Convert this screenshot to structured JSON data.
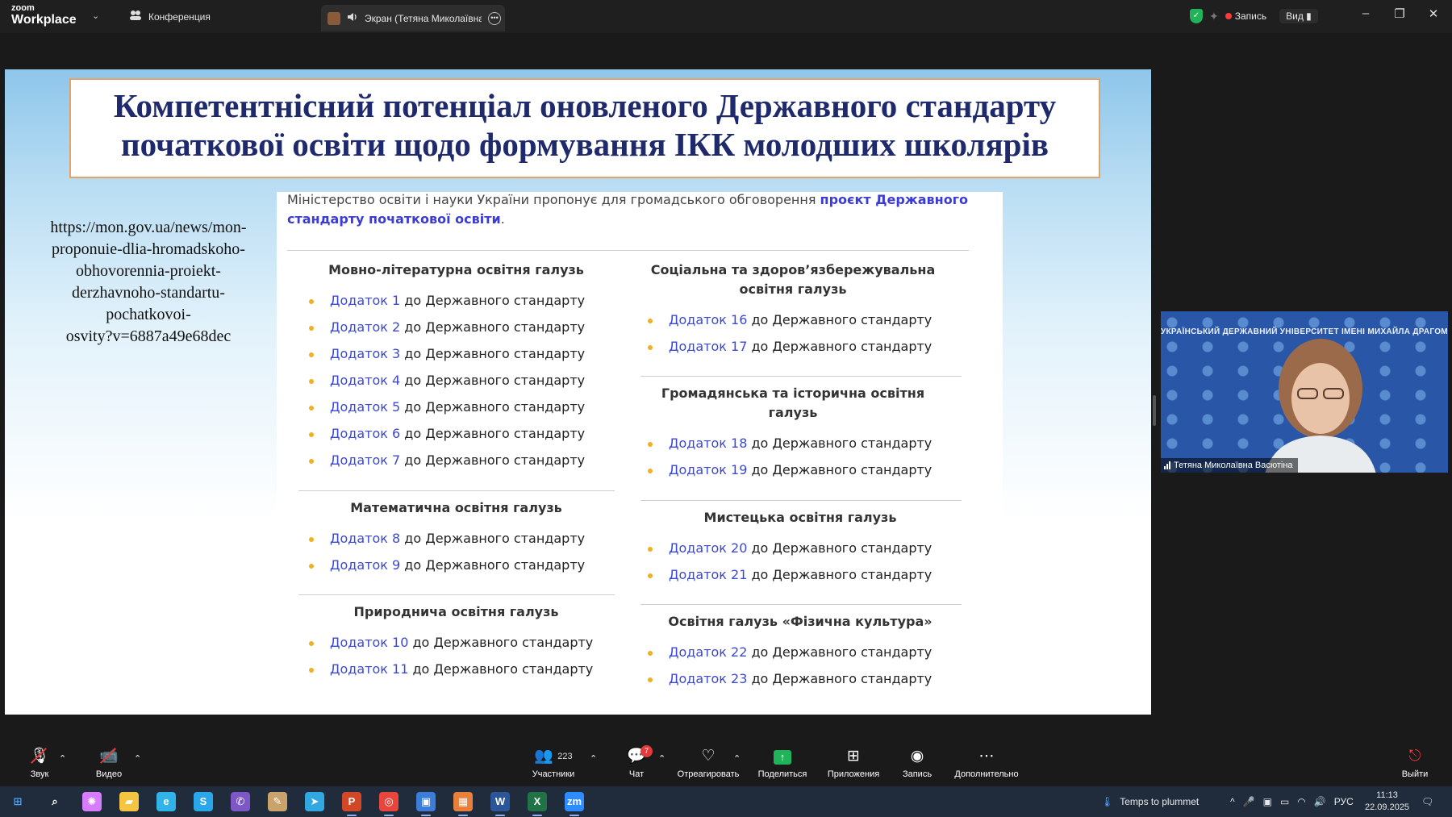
{
  "titlebar": {
    "logo_small": "zoom",
    "logo_big": "Workplace",
    "conference_label": "Конференция",
    "screen_tab_label": "Экран (Тетяна Миколаївна В",
    "record_label": "Запись",
    "view_label": "Вид",
    "colors": {
      "shield": "#1fb35a",
      "record_dot": "#ff3b3b"
    }
  },
  "slide": {
    "title_line1": "Компетентнісний потенціал оновленого Державного стандарту",
    "title_line2": "початкової освіти щодо формування ІКК молодших школярів",
    "url_lines": [
      "https://mon.gov.ua/news/mon-",
      "proponuie-dlia-hromadskoho-",
      "obhovorennia-proiekt-",
      "derzhavnoho-standartu-",
      "pochatkovoi-",
      "osvity?v=6887a49e68dec"
    ],
    "intro_text": "Міністерство освіти і науки України пропонує для громадського обговорення ",
    "intro_link": "проєкт Державного стандарту початкової освіти",
    "intro_end": ".",
    "suffix": " до Державного стандарту",
    "left_column": [
      {
        "heading": "Мовно-літературна освітня галузь",
        "items": [
          "Додаток 1",
          "Додаток 2",
          "Додаток 3",
          "Додаток 4",
          "Додаток 5",
          "Додаток 6",
          "Додаток 7"
        ]
      },
      {
        "heading": "Математична освітня галузь",
        "items": [
          "Додаток 8",
          "Додаток 9"
        ]
      },
      {
        "heading": "Природнича освітня галузь",
        "items": [
          "Додаток 10",
          "Додаток 11"
        ]
      }
    ],
    "right_column": [
      {
        "heading": "Соціальна та здоров’язбережувальна освітня галузь",
        "items": [
          "Додаток 16",
          "Додаток 17"
        ]
      },
      {
        "heading": "Громадянська та історична освітня галузь",
        "items": [
          "Додаток 18",
          "Додаток 19"
        ]
      },
      {
        "heading": "Мистецька освітня галузь",
        "items": [
          "Додаток 20",
          "Додаток 21"
        ]
      },
      {
        "heading": "Освітня галузь «Фізична культура»",
        "items": [
          "Додаток 22",
          "Додаток 23"
        ]
      }
    ],
    "colors": {
      "title": "#1e2a6c",
      "link": "#3b48d0",
      "bullet": "#f0b020",
      "title_border": "#e2a26a"
    }
  },
  "video": {
    "banner_text": "УКРАЇНСЬКИЙ ДЕРЖАВНИЙ УНІВЕРСИТЕТ ІМЕНІ МИХАЙЛА ДРАГОМАНОВА",
    "name": "Тетяна Миколаївна Васютіна"
  },
  "toolbar": {
    "audio": "Звук",
    "video": "Видео",
    "participants": "Участники",
    "participants_count": "223",
    "chat": "Чат",
    "chat_badge": "7",
    "react": "Отреагировать",
    "share": "Поделиться",
    "apps": "Приложения",
    "record": "Запись",
    "more": "Дополнительно",
    "leave": "Выйти"
  },
  "taskbar": {
    "weather": "Temps to plummet",
    "language": "РУС",
    "time": "11:13",
    "date": "22.09.2025",
    "apps": [
      {
        "icon": "windows-start-icon",
        "color": "#4aa3ff"
      },
      {
        "icon": "search-icon",
        "color": "#ffffff"
      },
      {
        "icon": "copilot-icon",
        "color": "#d77cff"
      },
      {
        "icon": "file-explorer-icon",
        "color": "#f5c542"
      },
      {
        "icon": "edge-icon",
        "color": "#2fb3e8"
      },
      {
        "icon": "skype-icon",
        "color": "#2aa7e8"
      },
      {
        "icon": "viber-icon",
        "color": "#7d57c6"
      },
      {
        "icon": "paint-icon",
        "color": "#c9a36b"
      },
      {
        "icon": "telegram-icon",
        "color": "#32a8e2"
      },
      {
        "icon": "powerpoint-icon",
        "color": "#d24726"
      },
      {
        "icon": "chrome-icon",
        "color": "#e8453c"
      },
      {
        "icon": "photos-icon",
        "color": "#3b7dd8"
      },
      {
        "icon": "office-icon",
        "color": "#e8803c"
      },
      {
        "icon": "word-icon",
        "color": "#2b579a"
      },
      {
        "icon": "excel-icon",
        "color": "#217346"
      },
      {
        "icon": "zoom-icon",
        "color": "#2d8cff"
      }
    ]
  }
}
